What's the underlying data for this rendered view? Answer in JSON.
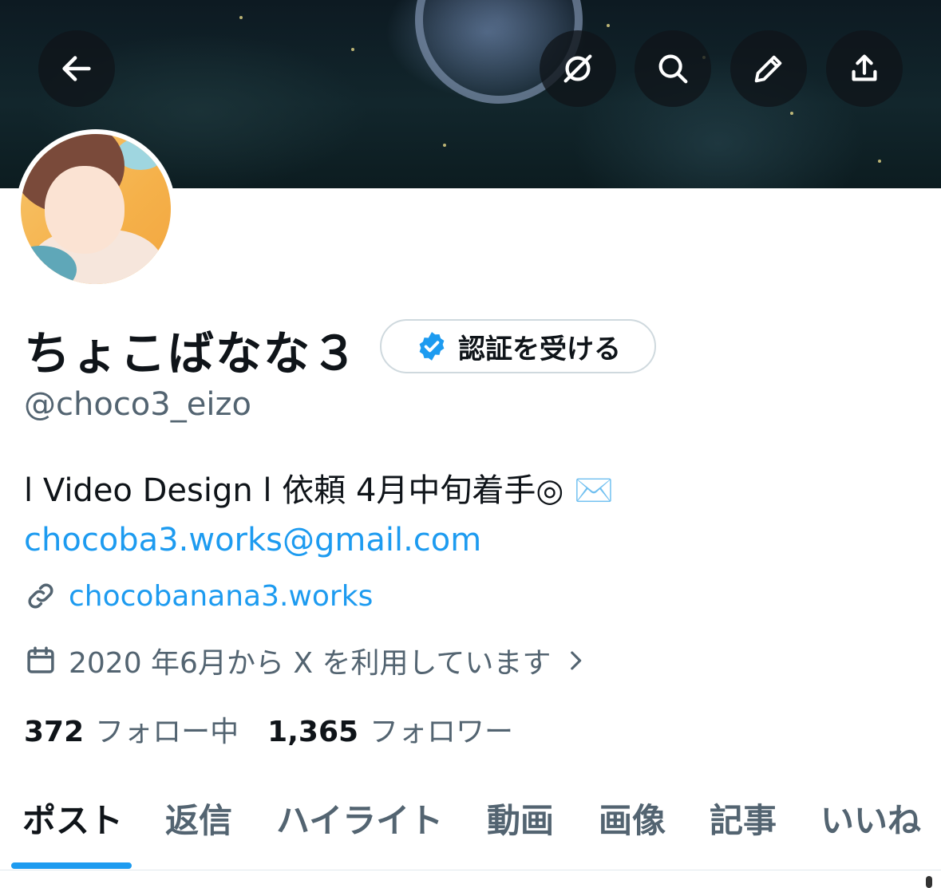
{
  "header": {
    "back_icon": "arrow-left-icon",
    "actions": [
      "grok-icon",
      "search-icon",
      "edit-icon",
      "share-icon"
    ]
  },
  "profile": {
    "display_name": "ちょこばなな３",
    "verify_button_label": "認証を受ける",
    "handle": "@choco3_eizo",
    "bio_line1": "l Video Design l 依頼 4月中旬着手◎ ✉️",
    "bio_email": "chocoba3.works@gmail.com",
    "website": "chocobanana3.works",
    "joined": "2020 年6月から X を利用しています",
    "following_count": "372",
    "following_label": "フォロー中",
    "followers_count": "1,365",
    "followers_label": "フォロワー"
  },
  "tabs": [
    {
      "label": "ポスト",
      "active": true
    },
    {
      "label": "返信",
      "active": false
    },
    {
      "label": "ハイライト",
      "active": false
    },
    {
      "label": "動画",
      "active": false
    },
    {
      "label": "画像",
      "active": false
    },
    {
      "label": "記事",
      "active": false
    },
    {
      "label": "いいね",
      "active": false
    }
  ],
  "colors": {
    "accent": "#1d9bf0",
    "text_primary": "#0f1419",
    "text_secondary": "#536471"
  }
}
